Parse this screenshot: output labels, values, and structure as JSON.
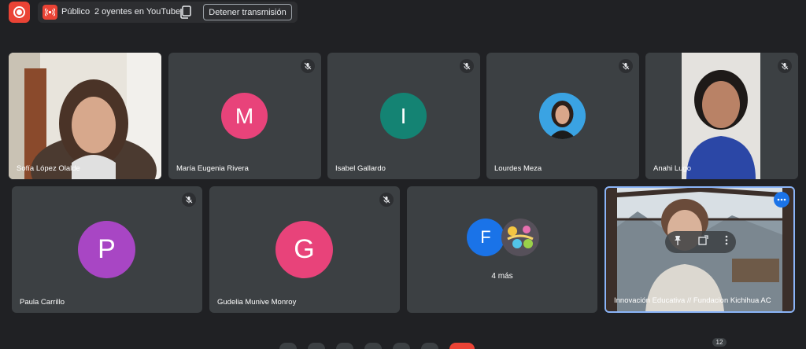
{
  "topbar": {
    "live_label": "Público",
    "viewers": "2 oyentes en YouTube",
    "stop_label": "Detener transmisión"
  },
  "colors": {
    "background": "#202124",
    "tile": "#3c4043",
    "accent_red": "#ea4335",
    "accent_blue": "#8ab4f8"
  },
  "participants": [
    {
      "name": "Sofía López Olalde",
      "type": "video"
    },
    {
      "name": "María Eugenia Rivera",
      "initial": "M",
      "avatar_color": "#e8437a",
      "muted": true
    },
    {
      "name": "Isabel Gallardo",
      "initial": "I",
      "avatar_color": "#148373",
      "muted": true
    },
    {
      "name": "Lourdes Meza",
      "type": "photo",
      "muted": true
    },
    {
      "name": "Anahi Lugo",
      "type": "video",
      "muted": true
    },
    {
      "name": "Paula Carrillo",
      "initial": "P",
      "avatar_color": "#a846c4",
      "muted": true
    },
    {
      "name": "Gudelia Munive Monroy",
      "initial": "G",
      "avatar_color": "#e8437a",
      "muted": true
    },
    {
      "name": "",
      "group_initial": "F",
      "group_label": "4 más",
      "avatar_color": "#1a73e8"
    },
    {
      "name": "Innovación Educativa // Fundacion Kichihua AC",
      "type": "video",
      "pinned_focus": true
    }
  ],
  "footer": {
    "participant_count": "12"
  }
}
